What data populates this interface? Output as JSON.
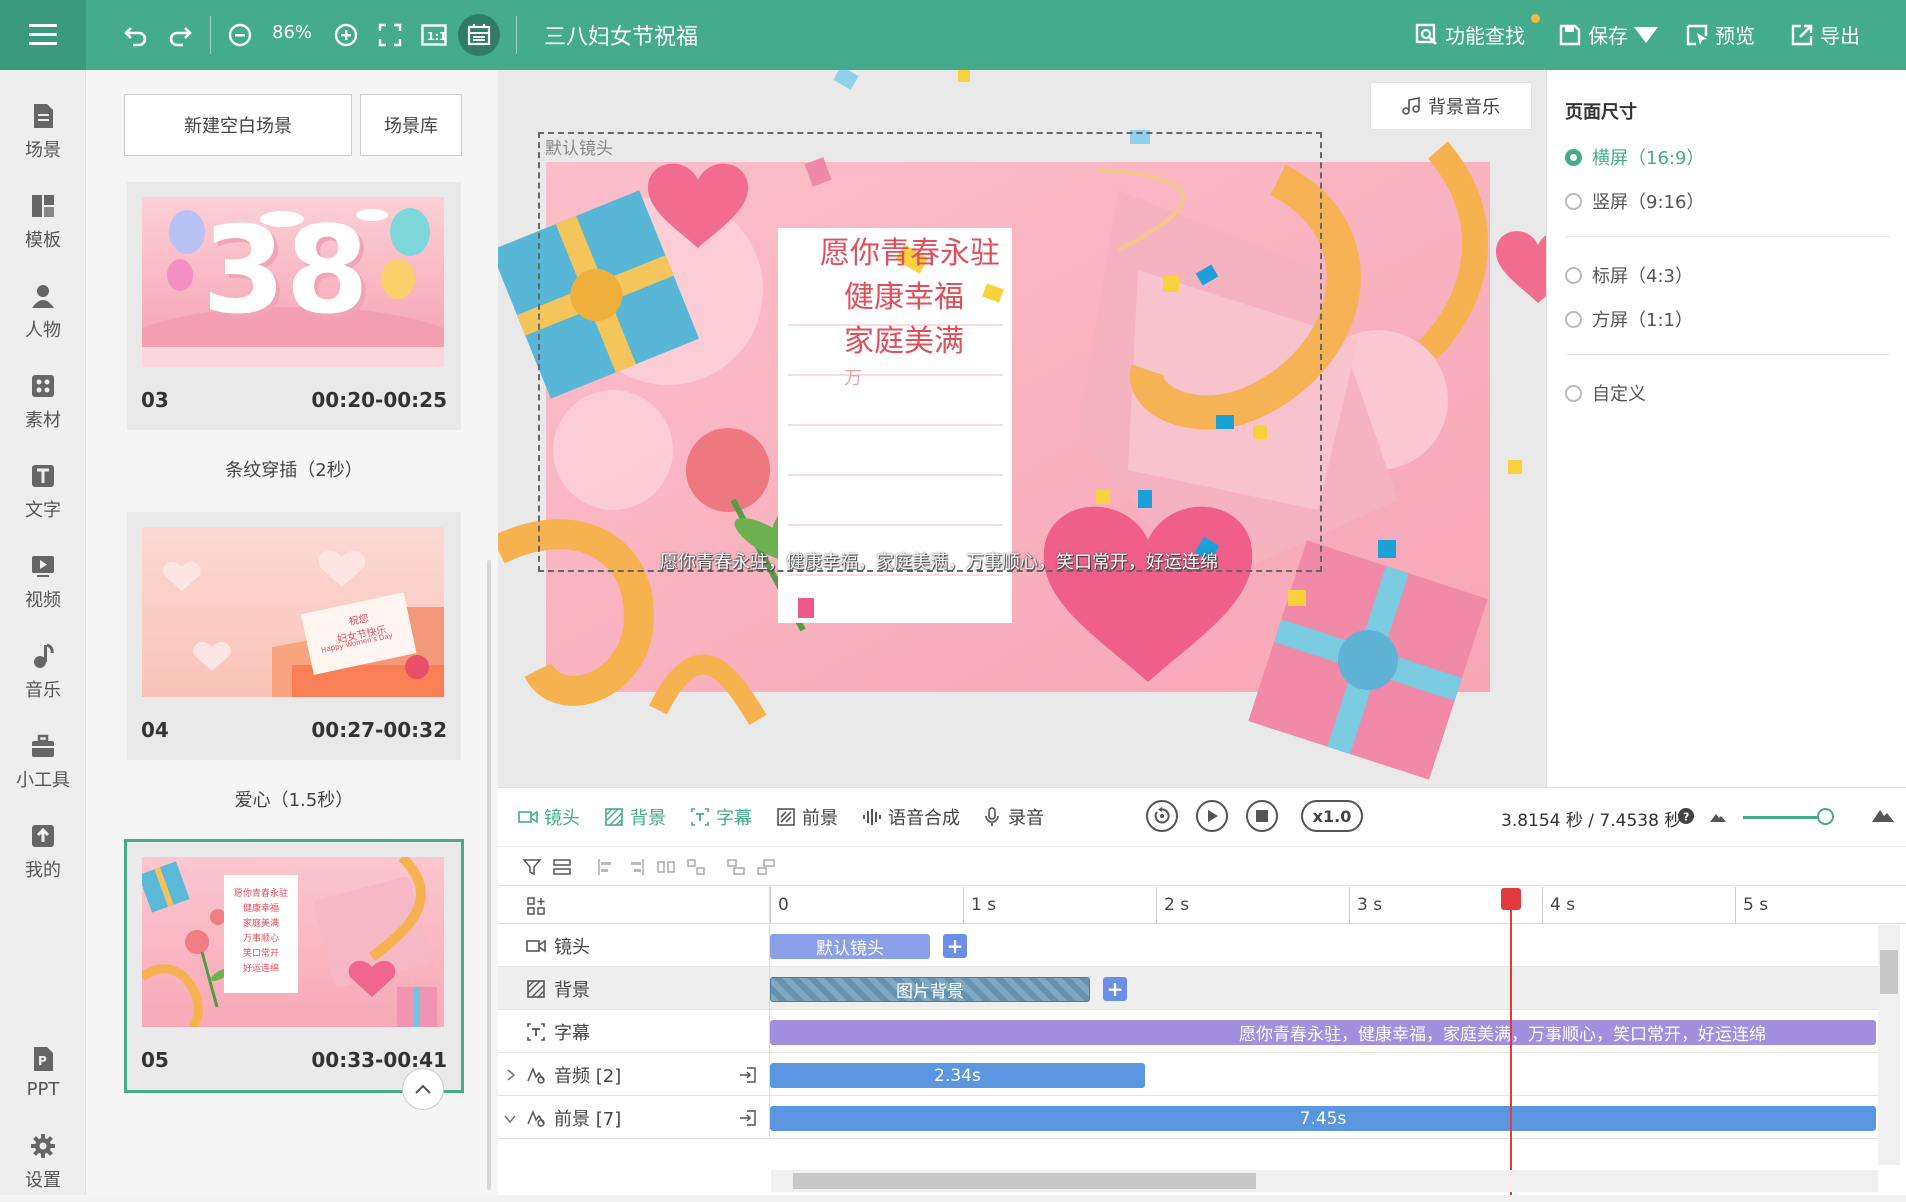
{
  "topbar": {
    "zoom": "86%",
    "title": "三八妇女节祝福",
    "actions": [
      "功能查找",
      "保存",
      "预览",
      "导出"
    ]
  },
  "nav": [
    "场景",
    "模板",
    "人物",
    "素材",
    "文字",
    "视频",
    "音乐",
    "小工具",
    "我的",
    "PPT",
    "设置"
  ],
  "scene_panel": {
    "new_blank": "新建空白场景",
    "library": "场景库",
    "scenes": [
      {
        "no": "03",
        "time": "00:20-00:25",
        "big_text": "38",
        "transition": "条纹穿插（2秒）"
      },
      {
        "no": "04",
        "time": "00:27-00:32",
        "card_text": "祝您\n妇女节快乐",
        "card_sub": "Happy Women's Day",
        "transition": "爱心（1.5秒）"
      },
      {
        "no": "05",
        "time": "00:33-00:41",
        "card_lines": [
          "愿你青春永驻",
          "健康幸福",
          "家庭美满",
          "万事顺心",
          "笑口常开",
          "好运连绵"
        ]
      }
    ]
  },
  "canvas": {
    "music_btn": "背景音乐",
    "camera_label": "默认镜头",
    "card_lines": [
      "愿你青春永驻",
      "健康幸福",
      "家庭美满",
      "万"
    ],
    "subtitle": "愿你青春永驻，健康幸福，家庭美满，万事顺心，笑口常开，好运连绵"
  },
  "right_panel": {
    "title": "页面尺寸",
    "options": [
      {
        "label": "横屏（16:9）",
        "selected": true
      },
      {
        "label": "竖屏（9:16）",
        "selected": false
      },
      {
        "label": "标屏（4:3）",
        "selected": false
      },
      {
        "label": "方屏（1:1）",
        "selected": false
      },
      {
        "label": "自定义",
        "selected": false
      }
    ]
  },
  "timeline": {
    "tabs": [
      "镜头",
      "背景",
      "字幕",
      "前景",
      "语音合成",
      "录音"
    ],
    "speed": "x1.0",
    "time_readout": "3.8154 秒 / 7.4538 秒",
    "ruler": [
      "0",
      "1 s",
      "2 s",
      "3 s",
      "4 s",
      "5 s"
    ],
    "tracks": [
      {
        "label": "镜头",
        "clip": "默认镜头",
        "color": "#8b9ee8"
      },
      {
        "label": "背景",
        "clip": "图片背景",
        "color": "#7fa8c2"
      },
      {
        "label": "字幕",
        "clip": "愿你青春永驻，健康幸福，家庭美满，万事顺心，笑口常开，好运连绵",
        "color": "#a28fe0"
      },
      {
        "label": "音频 [2]",
        "clip": "2.34s",
        "color": "#5b97e0"
      },
      {
        "label": "前景 [7]",
        "clip": "7.45s",
        "color": "#5b97e0"
      }
    ]
  },
  "colors": {
    "accent": "#44ac8b",
    "playhead": "#e23b3b"
  }
}
